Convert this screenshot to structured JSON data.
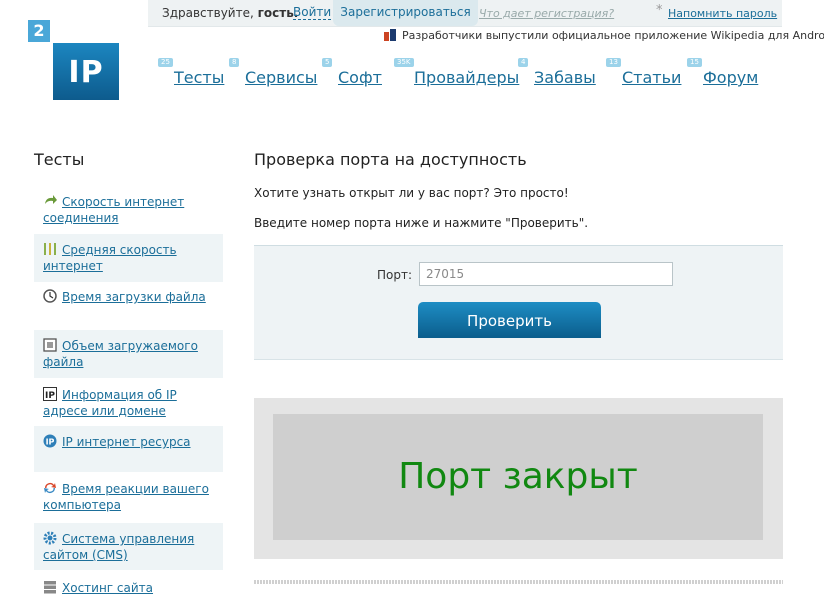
{
  "topbar": {
    "greeting": "Здравствуйте,",
    "guest": "гость.",
    "login": "Войти",
    "register": "Зарегистрироваться",
    "what_registration": "Что дает регистрация?",
    "star": "*",
    "remind_password": "Напомнить пароль"
  },
  "news": {
    "text": "Разработчики выпустили официальное приложение Wikipedia для Android"
  },
  "logo": {
    "badge": "2",
    "text": "IP"
  },
  "nav": [
    {
      "count": "25",
      "label": "Тесты"
    },
    {
      "count": "8",
      "label": "Сервисы"
    },
    {
      "count": "5",
      "label": "Софт"
    },
    {
      "count": "35K",
      "label": "Провайдеры"
    },
    {
      "count": "4",
      "label": "Забавы"
    },
    {
      "count": "13",
      "label": "Статьи"
    },
    {
      "count": "15",
      "label": "Форум"
    }
  ],
  "sidebar": {
    "title": "Тесты",
    "items": [
      {
        "label": "Скорость интернет соединения",
        "icon": "speed-arrow-icon"
      },
      {
        "label": "Средняя скорость интернет",
        "icon": "bars-icon"
      },
      {
        "label": "Время загрузки файла",
        "icon": "clock-icon"
      },
      {
        "label": "Объем загружаемого файла",
        "icon": "box-icon"
      },
      {
        "label": "Информация об IP адресе или домене",
        "icon": "ip-icon"
      },
      {
        "label": "IP интернет ресурса",
        "icon": "ip-globe-icon"
      },
      {
        "label": "Время реакции вашего компьютера",
        "icon": "refresh-icon"
      },
      {
        "label": "Система управления сайтом (CMS)",
        "icon": "gear-icon"
      },
      {
        "label": "Хостинг сайта",
        "icon": "server-icon"
      }
    ]
  },
  "content": {
    "title": "Проверка порта на доступность",
    "intro": "Хотите узнать открыт ли у вас порт? Это просто!",
    "instruction": "Введите номер порта ниже и нажмите \"Проверить\".",
    "port_label": "Порт:",
    "port_value": "27015",
    "check_button": "Проверить",
    "result": "Порт закрыт"
  }
}
